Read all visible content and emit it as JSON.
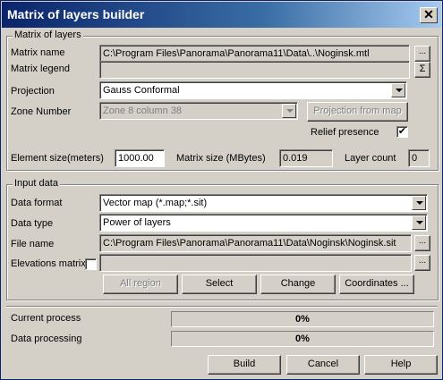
{
  "window": {
    "title": "Matrix of layers builder",
    "close_glyph": "✕"
  },
  "matrix_group": {
    "caption": "Matrix of layers",
    "matrix_name_label": "Matrix name",
    "matrix_name_value": "C:\\Program Files\\Panorama\\Panorama11\\Data\\..\\Noginsk.mtl",
    "browse_glyph": "...",
    "matrix_legend_label": "Matrix legend",
    "matrix_legend_value": "",
    "legend_button_glyph": "Σ",
    "projection_label": "Projection",
    "projection_value": "Gauss Conformal",
    "zone_label": "Zone Number",
    "zone_value": "Zone  8 column 38",
    "projection_from_map_label": "Projection from map",
    "relief_label": "Relief presence",
    "relief_checked": "✔",
    "element_size_label": "Element size(meters)",
    "element_size_value": "1000.00",
    "matrix_size_label": "Matrix size (MBytes)",
    "matrix_size_value": "0.019",
    "layer_count_label": "Layer count",
    "layer_count_value": "0"
  },
  "input_group": {
    "caption": "Input data",
    "data_format_label": "Data format",
    "data_format_value": "Vector map (*.map;*.sit)",
    "data_type_label": "Data type",
    "data_type_value": "Power of layers",
    "file_name_label": "File name",
    "file_name_value": "C:\\Program Files\\Panorama\\Panorama11\\Data\\Noginsk\\Noginsk.sit",
    "browse_glyph": "...",
    "elevations_label": "Elevations matrix",
    "elevations_value": "",
    "all_region_label": "All region",
    "select_label": "Select",
    "change_label": "Change",
    "coordinates_label": "Coordinates ..."
  },
  "progress": {
    "current_process_label": "Current process",
    "current_process_value": "0%",
    "current_process_fraction": 0,
    "data_processing_label": "Data processing",
    "data_processing_value": "0%",
    "data_processing_fraction": 0
  },
  "footer": {
    "build_label": "Build",
    "cancel_label": "Cancel",
    "help_label": "Help"
  }
}
